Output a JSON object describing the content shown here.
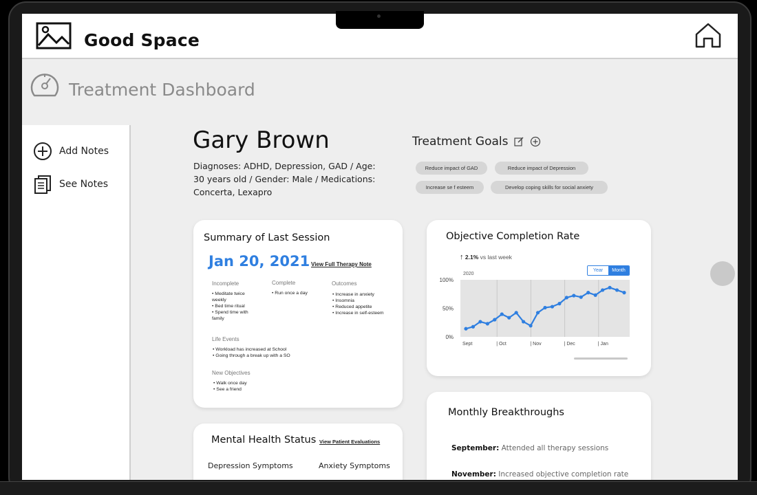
{
  "app": {
    "name": "Good Space"
  },
  "dashboard": {
    "title": "Treatment Dashboard"
  },
  "sidebar": {
    "items": [
      {
        "label": "Add Notes",
        "icon": "plus-circle-icon"
      },
      {
        "label": "See Notes",
        "icon": "notes-icon"
      }
    ]
  },
  "patient": {
    "name": "Gary Brown",
    "info": "Diagnoses: ADHD, Depression, GAD / Age: 30 years old / Gender: Male /  Medications: Concerta, Lexapro"
  },
  "goals": {
    "title": "Treatment Goals",
    "items": [
      "Reduce impact of GAD",
      "Reduce impact of Depression",
      "Increase se f esteem",
      "Develop coping skills for social anxiety"
    ]
  },
  "summary": {
    "title": "Summary of Last Session",
    "date": "Jan 20, 2021",
    "link": "View Full Therapy Note",
    "incomplete": {
      "label": "Incomplete",
      "items": [
        "Meditate twice weekly",
        "Bed time ritual",
        "Spend time with family"
      ]
    },
    "complete": {
      "label": "Complete",
      "items": [
        "Run once a day"
      ]
    },
    "outcomes": {
      "label": "Outcomes",
      "items": [
        "Increase in anxiety",
        "Insomnia",
        "Reduced appetite",
        "Increase in self-esteem"
      ]
    },
    "life_events": {
      "label": "Life Events",
      "items": [
        "Workload has increased at School",
        "Going through a break up with a SO"
      ]
    },
    "new_objectives": {
      "label": "New Objectives",
      "items": [
        "Walk once day",
        "See a friend"
      ]
    }
  },
  "objective": {
    "title": "Objective Completion Rate",
    "change_value": "2.1%",
    "change_text": "vs last week",
    "toggle_off": "Year",
    "toggle_on": "Month"
  },
  "chart_data": {
    "type": "line",
    "series_label": "2020",
    "x": [
      "Sept",
      "",
      "",
      "",
      "",
      "",
      "",
      "Oct",
      "",
      "",
      "",
      "",
      "",
      "Nov",
      "",
      "",
      "",
      "",
      "",
      "Dec",
      "",
      "",
      "",
      "",
      "",
      "Jan",
      "",
      "",
      ""
    ],
    "x_tick_labels": [
      "Sept",
      "| Oct",
      "| Nov",
      "| Dec",
      "| Jan"
    ],
    "y_tick_labels": [
      "100%",
      "50%",
      "0%"
    ],
    "values": [
      8,
      12,
      22,
      18,
      26,
      37,
      30,
      40,
      22,
      14,
      40,
      50,
      52,
      58,
      70,
      74,
      71,
      80,
      75,
      85,
      90,
      85,
      80
    ],
    "ylim": [
      0,
      100
    ],
    "grid": true,
    "color": "#2f7fe0"
  },
  "breakthroughs": {
    "title": "Monthly Breakthroughs",
    "items": [
      {
        "month": "September:",
        "text": "Attended all therapy sessions"
      },
      {
        "month": "November:",
        "text": "Increased objective completion rate"
      }
    ]
  },
  "mental_health": {
    "title": "Mental Health Status",
    "link": "View Patient Evaluations",
    "depression": "Depression Symptoms",
    "anxiety": "Anxiety Symptoms"
  },
  "colors": {
    "accent": "#2f7fe0",
    "background": "#eeeeee",
    "card": "#ffffff"
  }
}
